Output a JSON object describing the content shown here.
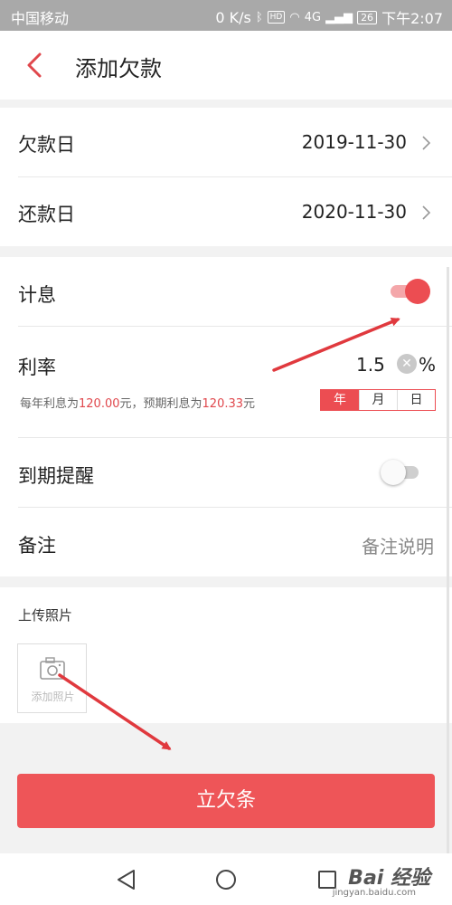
{
  "status_bar": {
    "carrier": "中国移动",
    "net_speed": "0 K/s",
    "hd": "HD",
    "network": "4G",
    "battery": "26",
    "time": "下午2:07"
  },
  "header": {
    "title": "添加欠款"
  },
  "form": {
    "loan_date": {
      "label": "欠款日",
      "value": "2019-11-30"
    },
    "repay_date": {
      "label": "还款日",
      "value": "2020-11-30"
    },
    "interest": {
      "label": "计息",
      "enabled": true
    },
    "rate": {
      "label": "利率",
      "value": "1.5",
      "unit": "%"
    },
    "interest_note": {
      "prefix": "每年利息为",
      "annual": "120.00",
      "middle": "元，预期利息为",
      "expected": "120.33",
      "suffix": "元"
    },
    "rate_period": {
      "options": [
        "年",
        "月",
        "日"
      ],
      "selected": "年"
    },
    "reminder": {
      "label": "到期提醒",
      "enabled": false
    },
    "remark": {
      "label": "备注",
      "placeholder": "备注说明"
    }
  },
  "upload": {
    "title": "上传照片",
    "button_label": "添加照片"
  },
  "submit": {
    "label": "立欠条"
  },
  "watermark": {
    "text": "Bai 经验",
    "sub": "jingyan.baidu.com"
  },
  "colors": {
    "accent": "#ec4d52",
    "annotation_arrow": "#e0393e"
  }
}
